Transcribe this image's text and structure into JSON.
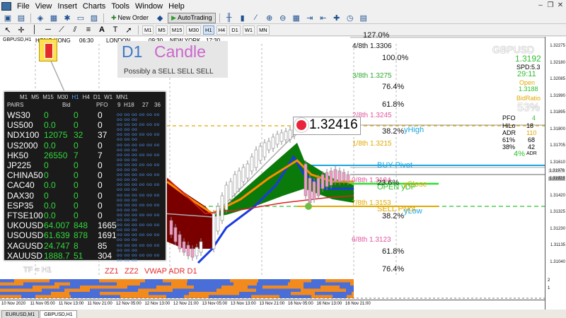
{
  "menu": {
    "items": [
      "File",
      "View",
      "Insert",
      "Charts",
      "Tools",
      "Window",
      "Help"
    ]
  },
  "toolbar": {
    "new_order": "New Order",
    "auto_trading": "AutoTrading",
    "timeframes": [
      "M1",
      "M5",
      "M15",
      "M30",
      "H1",
      "H4",
      "D1",
      "W1",
      "MN"
    ],
    "active_timeframe": "H1"
  },
  "chart": {
    "title": "GBPUSD,H1",
    "symbol_big": "GBPUSD",
    "sessions": [
      {
        "name": "HONG KONG",
        "time": "06:30"
      },
      {
        "name": "LONDON",
        "time": "09:30"
      },
      {
        "name": "NEW YORK",
        "time": "17:30"
      }
    ],
    "d1_title": "D1",
    "d1_candle": "Candle",
    "d1_sub": "Possibly a SELL SELL SELL",
    "big_price": "1.32416",
    "price_axis": [
      "1.32275",
      "1.32180",
      "1.32085",
      "1.31990",
      "1.31895",
      "1.31800",
      "1.31705",
      "1.31610",
      "1.31515",
      "1.31420",
      "1.31325",
      "1.31230",
      "1.31135",
      "1.31040"
    ],
    "price_axis_hl": [
      "1.31976",
      "1.31923"
    ],
    "murrey": [
      {
        "label": "127.0%",
        "color": "#111"
      },
      {
        "label": "4/8th  1.3306",
        "color": "#111"
      },
      {
        "label": "100.0%",
        "color": "#111"
      },
      {
        "label": "3/8th  1.3275",
        "color": "#2fa82f"
      },
      {
        "label": "76.4%",
        "color": "#111"
      },
      {
        "label": "61.8%",
        "color": "#111"
      },
      {
        "label": "2/8th  1.3245",
        "color": "#e0569c"
      },
      {
        "label": "38.2%",
        "color": "#111"
      },
      {
        "label": "1/8th  1.3215",
        "color": "#e0a800"
      },
      {
        "label": "0/8th  1.3184",
        "color": "#e0569c"
      },
      {
        "label": "23.6%",
        "color": "#111"
      },
      {
        "label": "7/8th  1.3153",
        "color": "#e0a800"
      },
      {
        "label": "38.2%",
        "color": "#111"
      },
      {
        "label": "6/8th  1.3123",
        "color": "#e0569c"
      },
      {
        "label": "61.8%",
        "color": "#111"
      },
      {
        "label": "76.4%",
        "color": "#111"
      }
    ],
    "overlays": {
      "yhigh": "yHigh",
      "buy_pivot": "BUY Pivot",
      "open_ydp": "OPEN yDP",
      "yclose": "yClose",
      "sell_pivot": "SELL Pivot",
      "ylow": "yLow",
      "tf_h1": "TF = H1",
      "zz1": "ZZ1",
      "zz2": "ZZ2",
      "vwap_adr": "VWAP ADR D1"
    },
    "info": {
      "price": "1.3192",
      "spd": "SPD:5.3",
      "time": "29:11",
      "open_label": "Open",
      "open_value": "1.3188",
      "bid_ratio": "BidRatio",
      "bid_pct": "53%",
      "pfo": "PFO",
      "pfo_val": "4",
      "hilo": "HiLo",
      "hilo_val": "18",
      "adr": "ADR",
      "adr_val": "110",
      "p1": "61%",
      "p1v": "68",
      "p2": "38%",
      "p2v": "42",
      "adr_pct": "4%",
      "adr_small": "ADR"
    }
  },
  "panel": {
    "tf_row": [
      "M1",
      "M5",
      "M15",
      "M30",
      "H1",
      "H4",
      "D1",
      "W1",
      "MN1"
    ],
    "tf_active": "H1",
    "headers": {
      "pairs": "PAIRS",
      "bid": "Bid",
      "pfo": "PFO",
      "n9": "9",
      "h18": "H18",
      "n27": "27",
      "n36": "36"
    },
    "rows": [
      {
        "pair": "WS30",
        "bid": "0",
        "chg": "0",
        "pfo": "0"
      },
      {
        "pair": "US500",
        "bid": "0.0",
        "chg": "0",
        "pfo": "0"
      },
      {
        "pair": "NDX100",
        "bid": "12075",
        "chg": "32",
        "pfo": "37"
      },
      {
        "pair": "US2000",
        "bid": "0.0",
        "chg": "0",
        "pfo": "0"
      },
      {
        "pair": "HK50",
        "bid": "26550",
        "chg": "7",
        "pfo": "7"
      },
      {
        "pair": "JP225",
        "bid": "0",
        "chg": "0",
        "pfo": "0"
      },
      {
        "pair": "CHINA50",
        "bid": "0",
        "chg": "0",
        "pfo": "0"
      },
      {
        "pair": "CAC40",
        "bid": "0.0",
        "chg": "0",
        "pfo": "0"
      },
      {
        "pair": "DAX30",
        "bid": "0",
        "chg": "0",
        "pfo": "0"
      },
      {
        "pair": "ESP35",
        "bid": "0.0",
        "chg": "0",
        "pfo": "0"
      },
      {
        "pair": "FTSE100",
        "bid": "0.0",
        "chg": "0",
        "pfo": "0"
      },
      {
        "pair": "UKOUSD",
        "bid": "64.007",
        "chg": "848",
        "pfo": "1665"
      },
      {
        "pair": "USOUSD",
        "bid": "61.639",
        "chg": "878",
        "pfo": "1691"
      },
      {
        "pair": "XAGUSD",
        "bid": "24.747",
        "chg": "8",
        "pfo": "85"
      },
      {
        "pair": "XAUUSD",
        "bid": "1888.7",
        "chg": "51",
        "pfo": "304"
      }
    ],
    "signals": "oo oo oo oo oo oo oo oo oo"
  },
  "time_axis": [
    "10 Nov 2020",
    "11 Nov 05:00",
    "11 Nov 13:00",
    "11 Nov 21:00",
    "12 Nov 05:00",
    "12 Nov 13:00",
    "12 Nov 21:00",
    "13 Nov 05:00",
    "13 Nov 13:00",
    "13 Nov 21:00",
    "16 Nov 05:00",
    "16 Nov 13:00",
    "16 Nov 21:00"
  ],
  "tabs": [
    "EURUSD,M1",
    "GBPUSD,H1"
  ],
  "active_tab": "GBPUSD,H1",
  "indicator_axis": [
    "2",
    "1"
  ]
}
